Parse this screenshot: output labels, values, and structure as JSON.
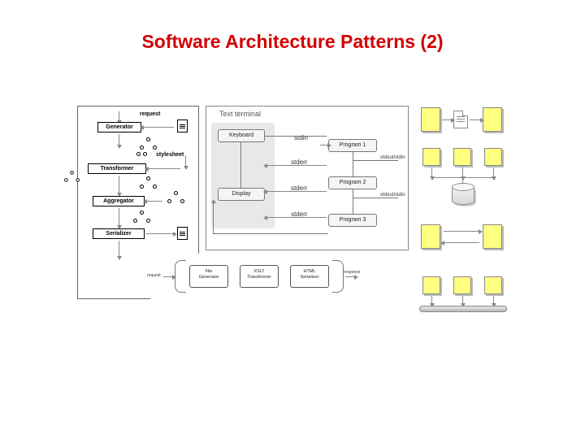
{
  "title": "Software Architecture Patterns (2)",
  "left_panel": {
    "request": "request",
    "generator": "Generator",
    "stylesheet": "stylesheet",
    "transformer": "Transformer",
    "aggregator": "Aggregator",
    "serializer": "Serializer"
  },
  "mid_panel": {
    "term_title": "Text terminal",
    "keyboard": "Keyboard",
    "display": "Display",
    "prog1": "Program 1",
    "prog2": "Program 2",
    "prog3": "Program 3",
    "stdin": "stdin",
    "stderr": "stderr",
    "stdio": "stdout/stdin"
  },
  "bottom_panel": {
    "req_in": "request",
    "res_out": "response",
    "file_gen": "File\nGenerator",
    "xslt": "XSLT\nTransformer",
    "html_ser": "HTML\nSerializer"
  }
}
